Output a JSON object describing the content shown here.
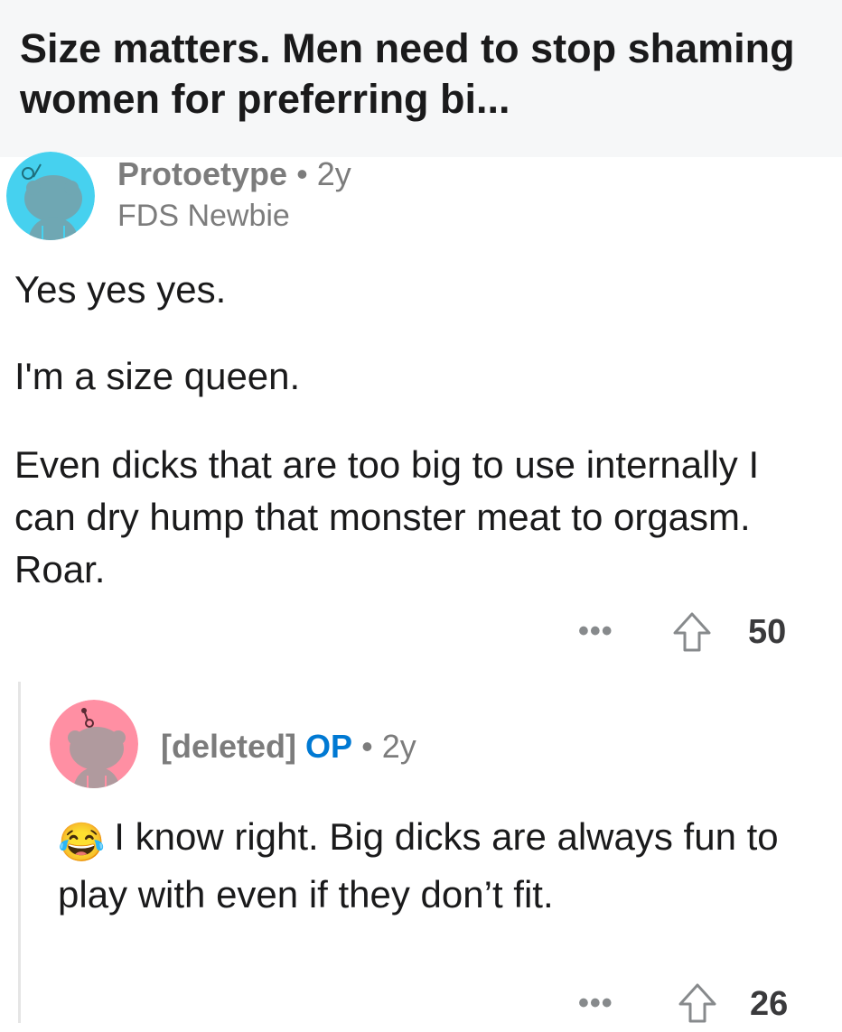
{
  "post": {
    "title": "Size matters. Men need to stop shaming women for preferring bi..."
  },
  "comments": [
    {
      "author": "Protoetype",
      "separator": "•",
      "age": "2y",
      "flair": "FDS Newbie",
      "avatar_color": "#46d1ef",
      "body": [
        "Yes yes yes.",
        "I'm a size queen.",
        "Even dicks that are too big to use internally I can dry hump that monster meat to orgasm. Roar."
      ],
      "more_label": "•••",
      "upvote_icon": "upvote-arrow-icon",
      "score": "50"
    },
    {
      "author": "[deleted]",
      "op_badge": "OP",
      "separator": "•",
      "age": "2y",
      "avatar_color": "#ff8fa3",
      "emoji": "😂",
      "body_text": "I know right. Big dicks are always fun to play with even if they don’t fit.",
      "more_label": "•••",
      "upvote_icon": "upvote-arrow-icon",
      "score": "26"
    }
  ],
  "colors": {
    "title_bg": "#f6f7f8",
    "meta_gray": "#7c7c7c",
    "op_blue": "#0079d3"
  }
}
